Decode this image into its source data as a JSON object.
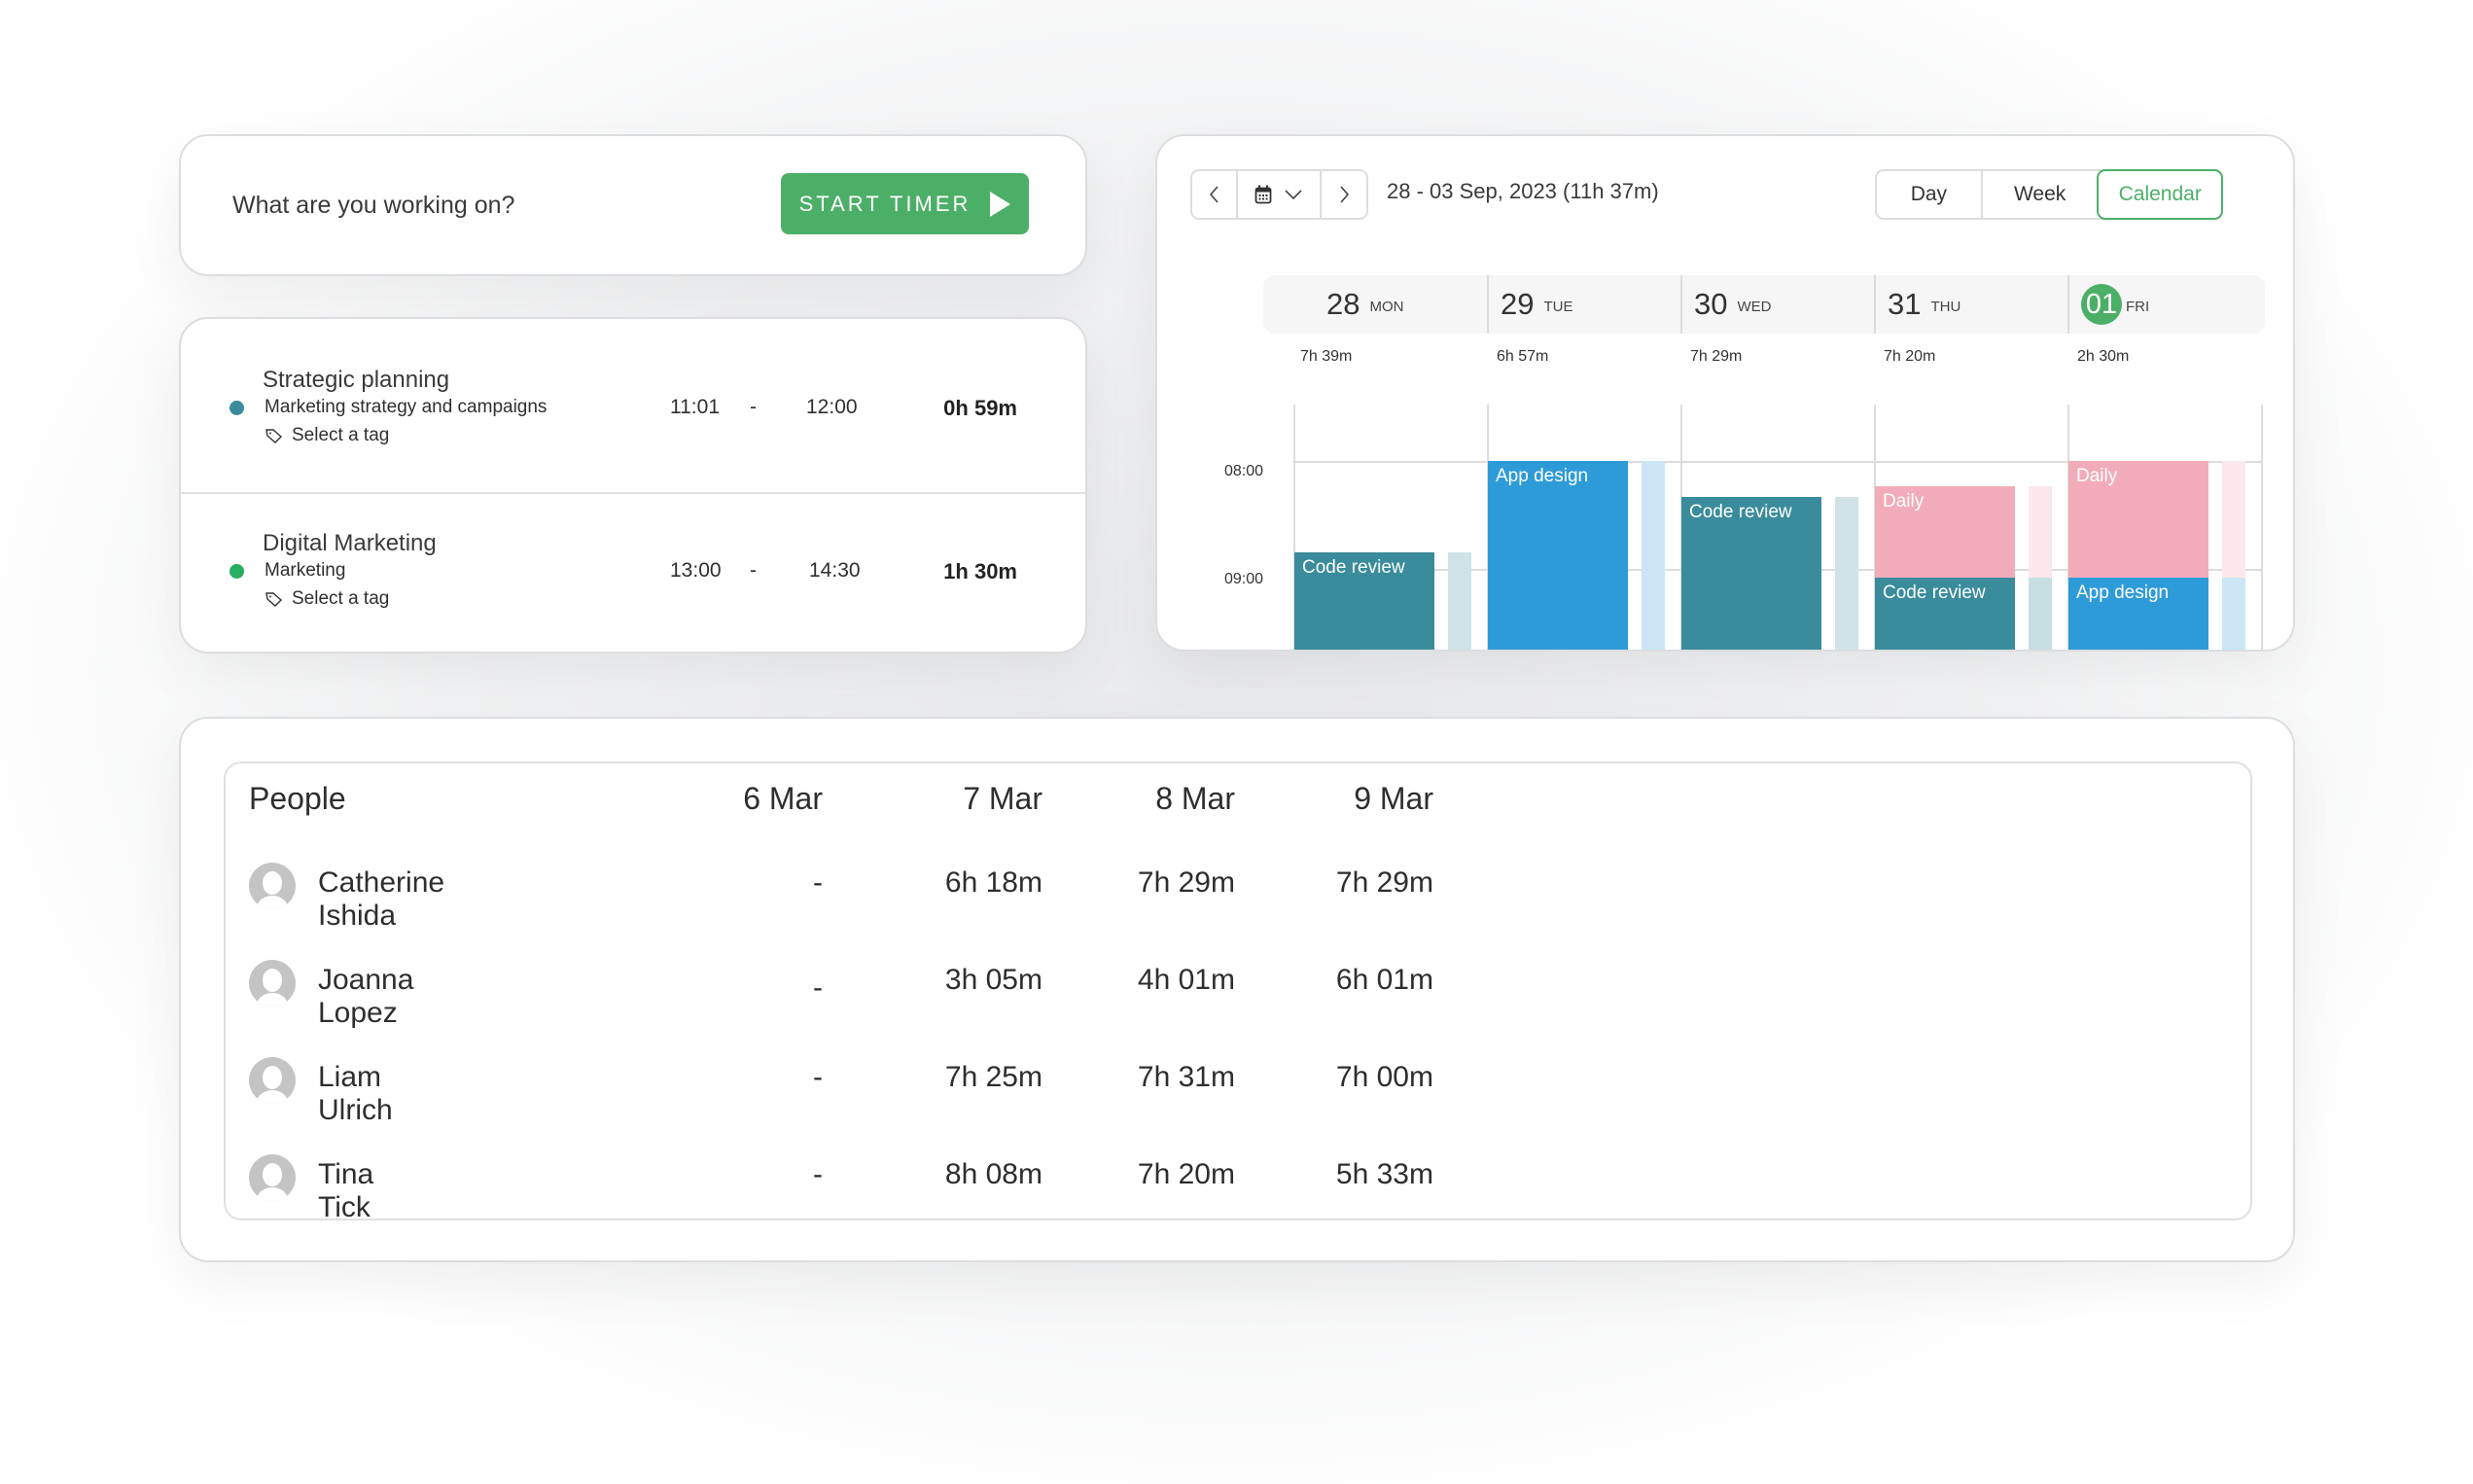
{
  "timer": {
    "prompt_placeholder": "What are you working on?",
    "start_label": "START TIMER"
  },
  "entries": [
    {
      "title": "Strategic planning",
      "project": "Marketing strategy and campaigns",
      "tag_label": "Select a tag",
      "start": "11:01",
      "separator": "-",
      "end": "12:00",
      "duration": "0h 59m",
      "dot_color": "#3a8c9c"
    },
    {
      "title": "Digital Marketing",
      "project": "Marketing",
      "tag_label": "Select a tag",
      "start": "13:00",
      "separator": "-",
      "end": "14:30",
      "duration": "1h 30m",
      "dot_color": "#27ae60"
    }
  ],
  "calendar": {
    "prev_icon": "chevron-left-icon",
    "picker_icon": "calendar-icon",
    "dropdown_icon": "chevron-down-icon",
    "next_icon": "chevron-right-icon",
    "date_range": "28 - 03 Sep, 2023 (11h 37m)",
    "views": [
      {
        "label": "Day",
        "active": false
      },
      {
        "label": "Week",
        "active": false
      },
      {
        "label": "Calendar",
        "active": true
      }
    ],
    "days": [
      {
        "num": "28",
        "dow": "MON",
        "total": "7h 39m",
        "today": false
      },
      {
        "num": "29",
        "dow": "TUE",
        "total": "6h 57m",
        "today": false
      },
      {
        "num": "30",
        "dow": "WED",
        "total": "7h 29m",
        "today": false
      },
      {
        "num": "31",
        "dow": "THU",
        "total": "7h 20m",
        "today": false
      },
      {
        "num": "01",
        "dow": "FRI",
        "total": "2h 30m",
        "today": true
      }
    ],
    "hours": [
      "08:00",
      "09:00"
    ],
    "events": [
      {
        "day": 0,
        "label": "Code review",
        "start": "08:51",
        "end": "10:30",
        "color": "#3a8c9c",
        "ghost": "#cfe3e6"
      },
      {
        "day": 1,
        "label": "App design",
        "start": "08:00",
        "end": "10:30",
        "color": "#2e9bd9",
        "ghost": "#cce6f5"
      },
      {
        "day": 2,
        "label": "Code review",
        "start": "08:20",
        "end": "10:30",
        "color": "#3a8c9c",
        "ghost": "#cfe3e6"
      },
      {
        "day": 3,
        "label": "Daily",
        "start": "08:14",
        "end": "09:05",
        "color": "#f2acb9",
        "ghost": "#fce8ec"
      },
      {
        "day": 3,
        "label": "Code review",
        "start": "09:05",
        "end": "10:30",
        "color": "#3a8c9c",
        "ghost": "#c8dfe2"
      },
      {
        "day": 4,
        "label": "Daily",
        "start": "08:00",
        "end": "09:05",
        "color": "#f2acb9",
        "ghost": "#fce8ec"
      },
      {
        "day": 4,
        "label": "App design",
        "start": "09:05",
        "end": "10:30",
        "color": "#2e9bd9",
        "ghost": "#cce6f5"
      }
    ]
  },
  "people": {
    "header": "People",
    "dates": [
      "6 Mar",
      "7 Mar",
      "8 Mar",
      "9 Mar"
    ],
    "rows": [
      {
        "name": "Catherine Ishida",
        "values": [
          "-",
          "6h 18m",
          "7h 29m",
          "7h 29m"
        ]
      },
      {
        "name": "Joanna Lopez",
        "values": [
          "-",
          "3h 05m",
          "4h 01m",
          "6h 01m"
        ]
      },
      {
        "name": "Liam Ulrich",
        "values": [
          "-",
          "7h 25m",
          "7h 31m",
          "7h 00m"
        ]
      },
      {
        "name": "Tina Tick",
        "values": [
          "-",
          "8h 08m",
          "7h 20m",
          "5h 33m"
        ]
      }
    ]
  },
  "colors": {
    "accent": "#4caf67",
    "code_review": "#3a8c9c",
    "app_design": "#2e9bd9",
    "daily": "#f2acb9"
  }
}
